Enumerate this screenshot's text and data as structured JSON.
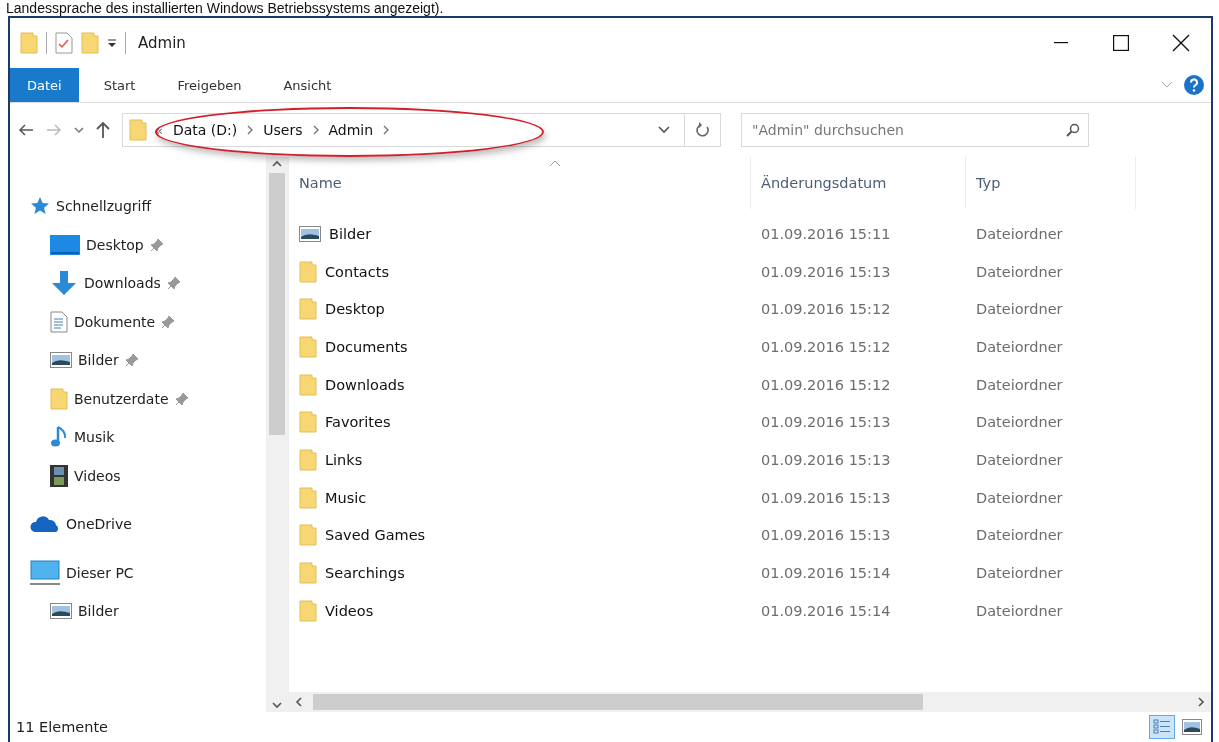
{
  "caption": "Landessprache des installierten Windows Betriebssystems angezeigt).",
  "window": {
    "title": "Admin"
  },
  "ribbon_tabs": [
    {
      "label": "Datei",
      "kind": "file"
    },
    {
      "label": "Start",
      "kind": "tab"
    },
    {
      "label": "Freigeben",
      "kind": "tab"
    },
    {
      "label": "Ansicht",
      "kind": "tab"
    }
  ],
  "address": {
    "overflow": "«",
    "crumbs": [
      "Data (D:)",
      "Users",
      "Admin"
    ],
    "highlighted": true
  },
  "search": {
    "placeholder": "\"Admin\" durchsuchen"
  },
  "sidebar": {
    "items": [
      {
        "label": "Schnellzugriff",
        "kind": "star",
        "pinned": false,
        "children": [
          {
            "label": "Desktop",
            "kind": "desktop",
            "pinned": true
          },
          {
            "label": "Downloads",
            "kind": "download",
            "pinned": true
          },
          {
            "label": "Dokumente",
            "kind": "document",
            "pinned": true
          },
          {
            "label": "Bilder",
            "kind": "pictures",
            "pinned": true
          },
          {
            "label": "Benutzerdate",
            "kind": "folder",
            "pinned": true
          },
          {
            "label": "Musik",
            "kind": "music",
            "pinned": false
          },
          {
            "label": "Videos",
            "kind": "video",
            "pinned": false
          }
        ]
      },
      {
        "label": "OneDrive",
        "kind": "cloud",
        "pinned": false
      },
      {
        "label": "Dieser PC",
        "kind": "computer",
        "pinned": false,
        "children": [
          {
            "label": "Bilder",
            "kind": "pictures",
            "pinned": false
          }
        ]
      }
    ]
  },
  "table": {
    "columns": [
      {
        "label": "Name",
        "sorted": true
      },
      {
        "label": "Änderungsdatum",
        "sorted": false
      },
      {
        "label": "Typ",
        "sorted": false
      }
    ],
    "rows": [
      {
        "kind": "pictures",
        "name": "Bilder",
        "date": "01.09.2016 15:11",
        "type": "Dateiordner"
      },
      {
        "kind": "folder",
        "name": "Contacts",
        "date": "01.09.2016 15:13",
        "type": "Dateiordner"
      },
      {
        "kind": "folder",
        "name": "Desktop",
        "date": "01.09.2016 15:12",
        "type": "Dateiordner"
      },
      {
        "kind": "folder",
        "name": "Documents",
        "date": "01.09.2016 15:12",
        "type": "Dateiordner"
      },
      {
        "kind": "folder",
        "name": "Downloads",
        "date": "01.09.2016 15:12",
        "type": "Dateiordner"
      },
      {
        "kind": "folder",
        "name": "Favorites",
        "date": "01.09.2016 15:13",
        "type": "Dateiordner"
      },
      {
        "kind": "folder",
        "name": "Links",
        "date": "01.09.2016 15:13",
        "type": "Dateiordner"
      },
      {
        "kind": "folder",
        "name": "Music",
        "date": "01.09.2016 15:13",
        "type": "Dateiordner"
      },
      {
        "kind": "folder",
        "name": "Saved Games",
        "date": "01.09.2016 15:13",
        "type": "Dateiordner"
      },
      {
        "kind": "folder",
        "name": "Searchings",
        "date": "01.09.2016 15:14",
        "type": "Dateiordner"
      },
      {
        "kind": "folder",
        "name": "Videos",
        "date": "01.09.2016 15:14",
        "type": "Dateiordner"
      }
    ]
  },
  "status_bar": {
    "count": "11 Elemente",
    "views": [
      {
        "kind": "details",
        "selected": true
      },
      {
        "kind": "large_icons",
        "selected": false
      }
    ]
  }
}
